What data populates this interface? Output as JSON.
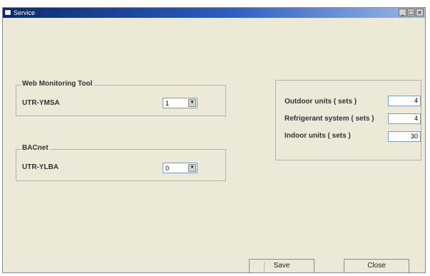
{
  "window": {
    "title": "Service",
    "minimize_glyph": "_",
    "maximize_glyph": "□",
    "close_glyph": "×"
  },
  "web_monitoring_tool": {
    "group_label": "Web Monitoring Tool",
    "item_label": "UTR-YMSA",
    "selected_value": "1",
    "dropdown_glyph": "▼"
  },
  "bacnet": {
    "group_label": "BACnet",
    "item_label": "UTR-YLBA",
    "selected_value": "0",
    "dropdown_glyph": "▼"
  },
  "units": {
    "outdoor_label": "Outdoor units ( sets )",
    "outdoor_value": "4",
    "refrigerant_label": "Refrigerant system ( sets )",
    "refrigerant_value": "4",
    "indoor_label": "Indoor units ( sets )",
    "indoor_value": "30"
  },
  "buttons": {
    "save_label": "Save",
    "close_label": "Close"
  }
}
